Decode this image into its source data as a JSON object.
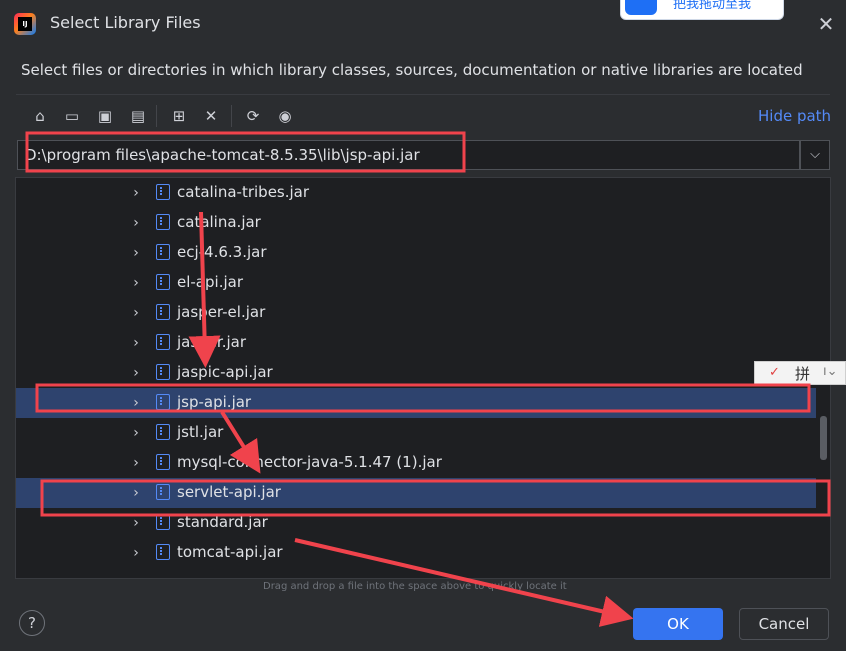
{
  "window": {
    "title": "Select Library Files",
    "app_icon": "intellij-idea-icon",
    "close_icon": "close-icon"
  },
  "overlay": {
    "badge_text": "把我拖动至我"
  },
  "description": "Select files or directories in which library classes, sources, documentation or native libraries are located",
  "toolbar": {
    "buttons": [
      {
        "name": "home-icon",
        "glyph": "⌂"
      },
      {
        "name": "desktop-icon",
        "glyph": "▭"
      },
      {
        "name": "project-folder-icon",
        "glyph": "▣"
      },
      {
        "name": "module-folder-icon",
        "glyph": "▤"
      },
      {
        "name": "new-folder-icon",
        "glyph": "⊞"
      },
      {
        "name": "delete-icon",
        "glyph": "✕"
      },
      {
        "name": "refresh-icon",
        "glyph": "⟳"
      },
      {
        "name": "show-hidden-icon",
        "glyph": "◉"
      }
    ],
    "hide_path_label": "Hide path"
  },
  "path_field": {
    "value": "D:\\program files\\apache-tomcat-8.5.35\\lib\\jsp-api.jar"
  },
  "tree": {
    "items": [
      {
        "label": "catalina-tribes.jar",
        "selected": false
      },
      {
        "label": "catalina.jar",
        "selected": false
      },
      {
        "label": "ecj-4.6.3.jar",
        "selected": false
      },
      {
        "label": "el-api.jar",
        "selected": false
      },
      {
        "label": "jasper-el.jar",
        "selected": false
      },
      {
        "label": "jasper.jar",
        "selected": false
      },
      {
        "label": "jaspic-api.jar",
        "selected": false
      },
      {
        "label": "jsp-api.jar",
        "selected": true
      },
      {
        "label": "jstl.jar",
        "selected": false
      },
      {
        "label": "mysql-connector-java-5.1.47 (1).jar",
        "selected": false
      },
      {
        "label": "servlet-api.jar",
        "selected": true
      },
      {
        "label": "standard.jar",
        "selected": false
      },
      {
        "label": "tomcat-api.jar",
        "selected": false
      }
    ]
  },
  "drag_hint": "Drag and drop a file into the space above to quickly locate it",
  "buttons": {
    "help_label": "?",
    "ok_label": "OK",
    "cancel_label": "Cancel"
  },
  "ime_bar": {
    "char": "拼"
  },
  "colors": {
    "background": "#2b2d30",
    "accent": "#3574f0",
    "selection": "#2e436e",
    "annotation_red": "#f0434c",
    "link": "#548af7"
  }
}
